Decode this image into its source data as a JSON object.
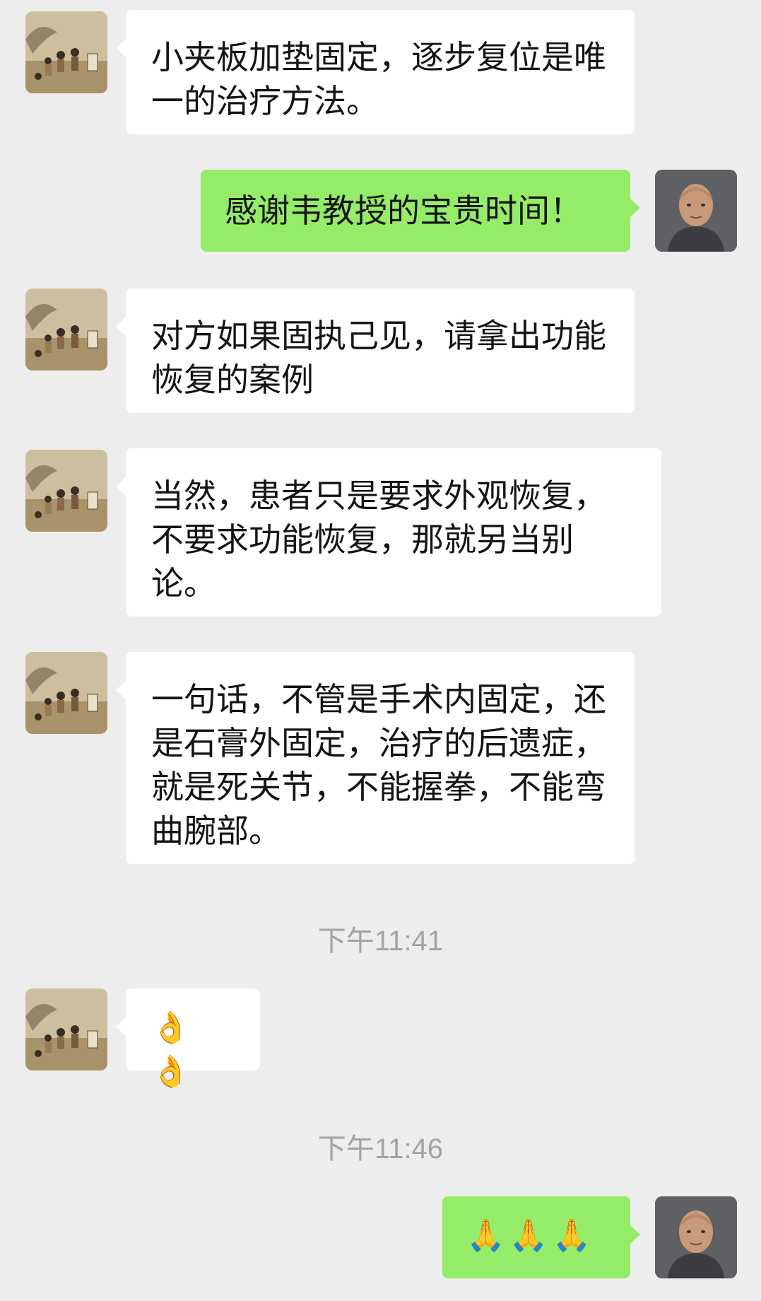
{
  "colors": {
    "background": "#ededed",
    "incoming_bubble": "#ffffff",
    "outgoing_bubble": "#95ec69",
    "timestamp_text": "#a3a3a3"
  },
  "messages": [
    {
      "side": "in",
      "text": "小夹板加垫固定，逐步复位是唯一的治疗方法。"
    },
    {
      "side": "out",
      "text": "感谢韦教授的宝贵时间！"
    },
    {
      "side": "in",
      "text": "对方如果固执己见，请拿出功能恢复的案例"
    },
    {
      "side": "in",
      "text": "当然，患者只是要求外观恢复，不要求功能恢复，那就另当别论。"
    },
    {
      "side": "in",
      "text": "一句话，不管是手术内固定，还是石膏外固定，治疗的后遗症，就是死关节，不能握拳，不能弯曲腕部。"
    },
    {
      "side": "in",
      "text": "👌👌"
    },
    {
      "side": "out",
      "text": "🙏🙏🙏"
    }
  ],
  "timestamps": [
    "下午11:41",
    "下午11:46"
  ],
  "avatars": {
    "contact": "painting-avatar-icon",
    "self": "man-portrait-avatar-icon"
  }
}
